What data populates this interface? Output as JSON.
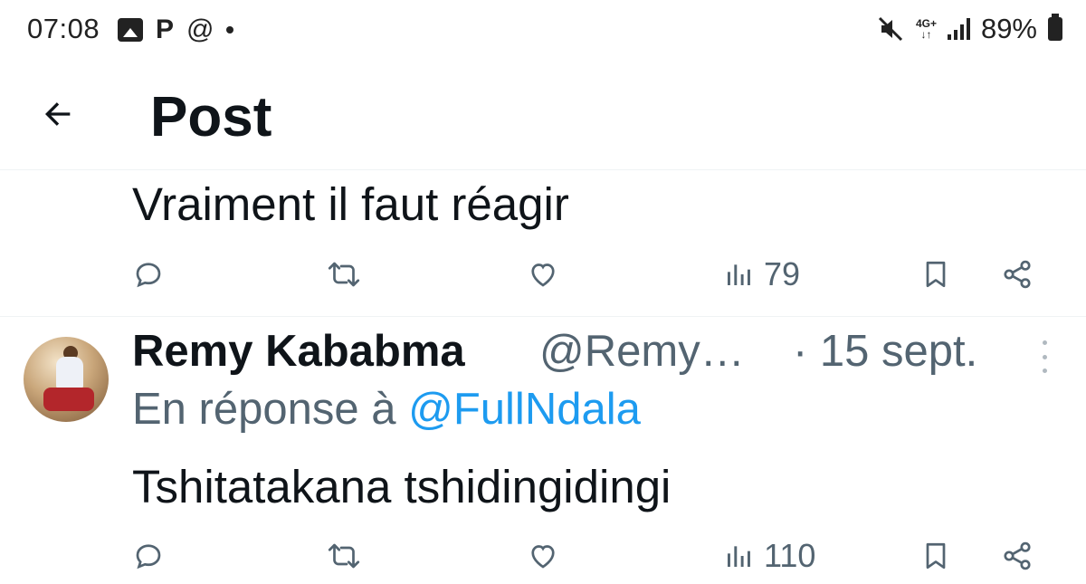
{
  "status_bar": {
    "time": "07:08",
    "left_icons": [
      "image-icon",
      "p-icon",
      "at-icon",
      "dot-icon"
    ],
    "p_glyph": "P",
    "at_glyph": "@",
    "network": "4G+",
    "battery": "89%",
    "right_icons": [
      "mute-icon",
      "network-4g-icon",
      "signal-icon",
      "battery-icon"
    ]
  },
  "header": {
    "back_icon": "arrow-left-icon",
    "title": "Post"
  },
  "post1": {
    "text": "Vraiment il faut réagir",
    "actions": {
      "views": "79"
    }
  },
  "post2": {
    "author_name": "Remy Kababma",
    "handle": "@Remy…",
    "date": "· 15 sept.",
    "reply_prefix": "En réponse à",
    "reply_mention": "@FullNdala",
    "text": "Tshitatakana tshidingidingi",
    "actions": {
      "views": "110"
    }
  },
  "colors": {
    "text_primary": "#0f1419",
    "text_secondary": "#536471",
    "accent": "#1d9bf0",
    "divider": "#eff3f4"
  }
}
